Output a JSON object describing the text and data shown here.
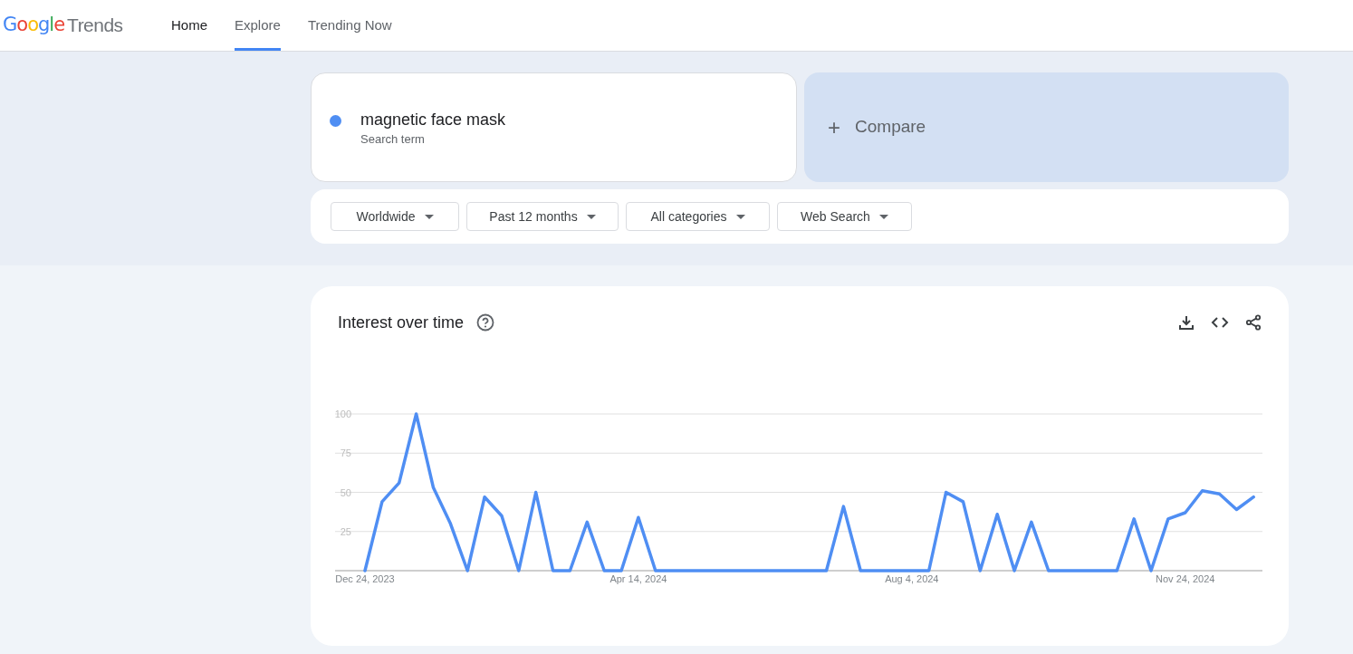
{
  "header": {
    "logo": {
      "brand": "Google",
      "product": "Trends"
    },
    "nav": [
      {
        "label": "Home",
        "selected": false
      },
      {
        "label": "Explore",
        "selected": true
      },
      {
        "label": "Trending Now",
        "selected": false
      }
    ]
  },
  "search": {
    "terms": [
      {
        "term": "magnetic face mask",
        "caption": "Search term",
        "color": "#4f8ef3"
      }
    ],
    "compare": {
      "icon": "+",
      "label": "Compare"
    }
  },
  "filters": [
    "Worldwide",
    "Past 12 months",
    "All categories",
    "Web Search"
  ],
  "interest_over_time": {
    "title": "Interest over time",
    "chart_data": {
      "type": "line",
      "grid": true,
      "categories": [
        "Dec 24, 2023",
        null,
        null,
        null,
        null,
        null,
        null,
        null,
        null,
        null,
        null,
        null,
        null,
        null,
        null,
        null,
        "Apr 14, 2024",
        null,
        null,
        null,
        null,
        null,
        null,
        null,
        null,
        null,
        null,
        null,
        null,
        null,
        null,
        null,
        "Aug 4, 2024",
        null,
        null,
        null,
        null,
        null,
        null,
        null,
        null,
        null,
        null,
        null,
        null,
        null,
        null,
        null,
        "Nov 24, 2024",
        null,
        null,
        null,
        null
      ],
      "series": [
        {
          "color": "#4f8ef3",
          "values": [
            0,
            44,
            56,
            100,
            53,
            30,
            0,
            47,
            35,
            0,
            50,
            0,
            0,
            31,
            0,
            0,
            34,
            0,
            0,
            0,
            0,
            0,
            0,
            0,
            0,
            0,
            0,
            0,
            41,
            0,
            0,
            0,
            0,
            0,
            50,
            44,
            0,
            36,
            0,
            31,
            0,
            0,
            0,
            0,
            0,
            33,
            0,
            33,
            37,
            51,
            49,
            39,
            47
          ]
        }
      ],
      "ylim": [
        0,
        100
      ],
      "yticks": [
        {
          "value": 25,
          "label": "25"
        },
        {
          "value": 50,
          "label": "50"
        },
        {
          "value": 75,
          "label": "75"
        },
        {
          "value": 100,
          "label": "100"
        }
      ]
    }
  }
}
